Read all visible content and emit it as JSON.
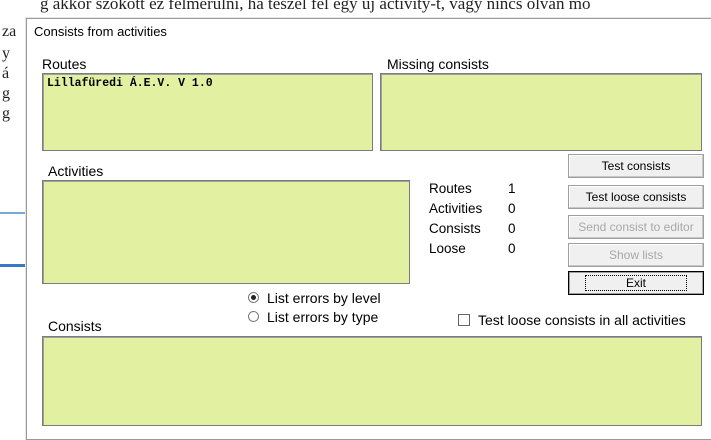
{
  "background": {
    "top_line": "g akkor szokott ez felmerülni, ha teszel fel egy új activity-t, vagy nincs olvan mó",
    "left_chars": [
      "za",
      "y",
      "á",
      "g",
      "g"
    ]
  },
  "dialog": {
    "title": "Consists from activities",
    "routes_label": "Routes",
    "routes_items": [
      "Lillafüredi Á.E.V. V 1.0"
    ],
    "missing_label": "Missing consists",
    "activities_label": "Activities",
    "consists_label": "Consists",
    "stats": [
      {
        "label": "Routes",
        "value": "1"
      },
      {
        "label": "Activities",
        "value": "0"
      },
      {
        "label": "Consists",
        "value": "0"
      },
      {
        "label": "Loose",
        "value": "0"
      }
    ],
    "buttons": {
      "test_consists": "Test consists",
      "test_loose": "Test loose consists",
      "send_to_editor": "Send consist to editor",
      "show_lists": "Show lists",
      "exit": "Exit"
    },
    "radio_level": "List errors by level",
    "radio_type": "List errors by type",
    "radio_selected": "level",
    "checkbox_label": "Test loose consists in all activities",
    "list_bg_color": "#e1f1a1"
  }
}
